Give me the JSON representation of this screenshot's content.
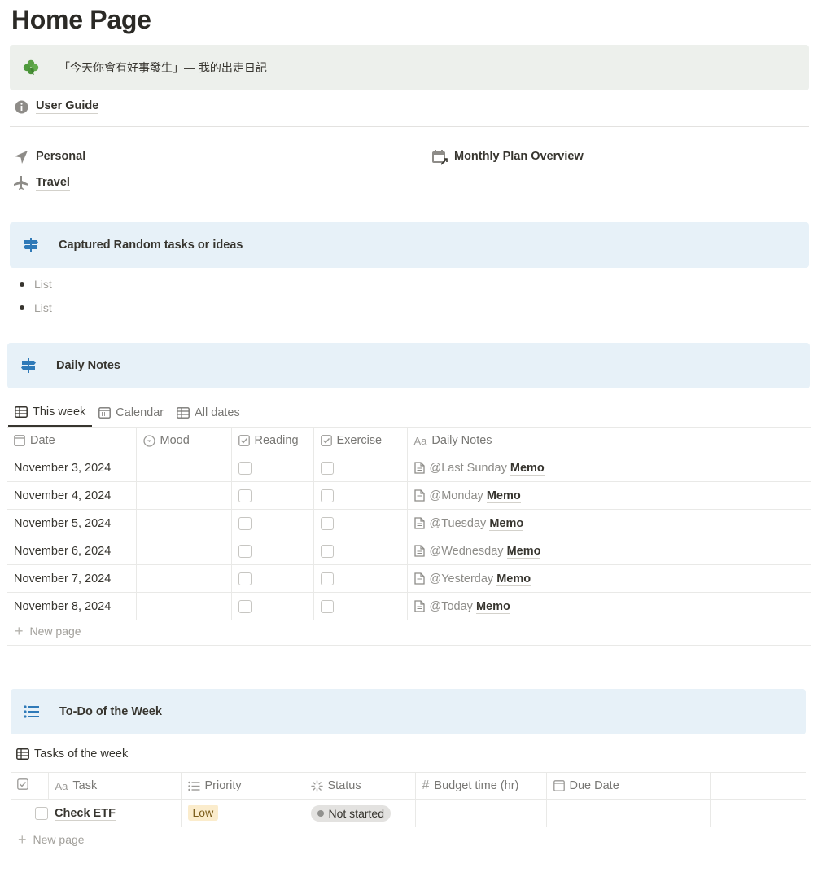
{
  "page": {
    "title": "Home Page"
  },
  "quote_callout": {
    "icon": "clover-icon",
    "text": "「今天你會有好事發生」— 我的出走日記"
  },
  "user_guide": {
    "icon": "info-icon",
    "label": "User Guide"
  },
  "links": {
    "personal": {
      "icon": "navigation-arrow-icon",
      "label": "Personal"
    },
    "travel": {
      "icon": "airplane-icon",
      "label": "Travel"
    },
    "monthly": {
      "icon": "calendar-arrow-icon",
      "label": "Monthly Plan Overview"
    }
  },
  "captured": {
    "icon": "signpost-icon",
    "title": "Captured Random tasks or ideas",
    "items": [
      "List",
      "List"
    ]
  },
  "daily_notes": {
    "icon": "signpost-icon",
    "title": "Daily Notes",
    "tabs": [
      {
        "label": "This week",
        "icon": "table-icon",
        "active": true
      },
      {
        "label": "Calendar",
        "icon": "calendar-icon",
        "active": false
      },
      {
        "label": "All dates",
        "icon": "table-icon",
        "active": false
      }
    ],
    "columns": [
      "Date",
      "Mood",
      "Reading",
      "Exercise",
      "Daily Notes"
    ],
    "column_icons": [
      "calendar-icon",
      "select-icon",
      "checkbox-icon",
      "checkbox-icon",
      "text-aa-icon"
    ],
    "rows": [
      {
        "date": "November 3, 2024",
        "mention": "@Last Sunday",
        "memo": "Memo"
      },
      {
        "date": "November 4, 2024",
        "mention": "@Monday",
        "memo": "Memo"
      },
      {
        "date": "November 5, 2024",
        "mention": "@Tuesday",
        "memo": "Memo"
      },
      {
        "date": "November 6, 2024",
        "mention": "@Wednesday",
        "memo": "Memo"
      },
      {
        "date": "November 7, 2024",
        "mention": "@Yesterday",
        "memo": "Memo"
      },
      {
        "date": "November 8, 2024",
        "mention": "@Today",
        "memo": "Memo"
      }
    ],
    "new_page": "New page"
  },
  "todo": {
    "icon": "list-icon",
    "title": "To-Do of the Week",
    "db_title": "Tasks of the week",
    "columns": [
      "Task",
      "Priority",
      "Status",
      "Budget time (hr)",
      "Due Date"
    ],
    "column_prefix": {
      "task": "Aa",
      "budget": "#"
    },
    "rows": [
      {
        "task": "Check ETF",
        "priority": "Low",
        "status": "Not started",
        "budget": "",
        "due": ""
      }
    ],
    "new_page": "New page"
  },
  "colors": {
    "callout_green": "#edf0ec",
    "callout_blue": "#e7f1f8",
    "signpost_blue": "#2f7ab8",
    "priority_low_bg": "#fbeccc",
    "status_bg": "#e3e2e0"
  }
}
